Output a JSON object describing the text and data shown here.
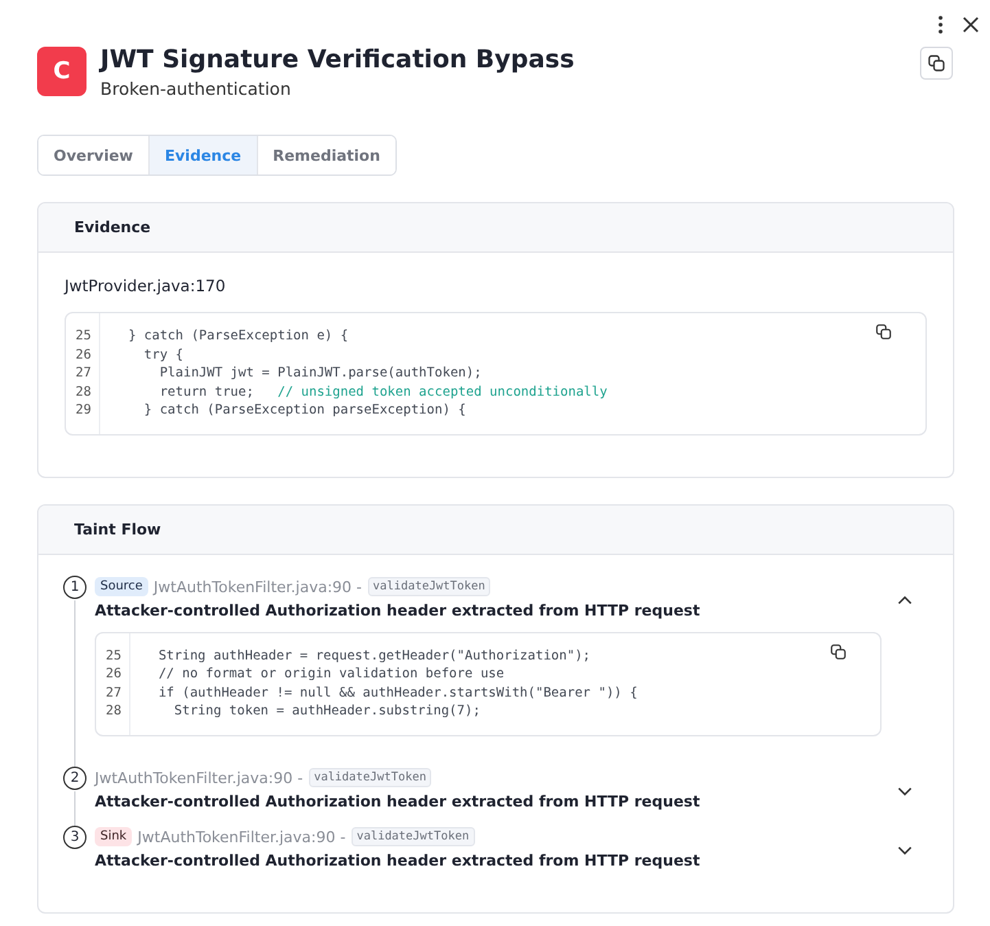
{
  "header": {
    "severity_letter": "C",
    "title": "JWT Signature Verification Bypass",
    "category": "Broken-authentication"
  },
  "tabs": [
    {
      "label": "Overview",
      "selected": false
    },
    {
      "label": "Evidence",
      "selected": true
    },
    {
      "label": "Remediation",
      "selected": false
    }
  ],
  "evidence": {
    "title": "Evidence",
    "location": "JwtProvider.java:170",
    "code": [
      {
        "number": "25",
        "code": "  } catch (ParseException e) {"
      },
      {
        "number": "26",
        "code": "    try {"
      },
      {
        "number": "27",
        "code": "      PlainJWT jwt = PlainJWT.parse(authToken);"
      },
      {
        "number": "28",
        "code": "      return true;   ",
        "comment": "// unsigned token accepted unconditionally"
      },
      {
        "number": "29",
        "code": "    } catch (ParseException parseException) {"
      }
    ]
  },
  "taint_flow": {
    "title": "Taint Flow",
    "steps": [
      {
        "number": "1",
        "badge": "Source",
        "kind": "source",
        "location": "JwtAuthTokenFilter.java:90 -",
        "method": "validateJwtToken",
        "description": "Attacker-controlled Authorization header extracted from HTTP request",
        "expanded": true,
        "code": [
          {
            "number": "25",
            "code": "  String authHeader = request.getHeader(\"Authorization\");"
          },
          {
            "number": "26",
            "code": "  // no format or origin validation before use"
          },
          {
            "number": "27",
            "code": "  if (authHeader != null && authHeader.startsWith(\"Bearer \")) {"
          },
          {
            "number": "28",
            "code": "    String token = authHeader.substring(7);"
          }
        ]
      },
      {
        "number": "2",
        "kind": "step",
        "location": "JwtAuthTokenFilter.java:90 -",
        "method": "validateJwtToken",
        "description": "Attacker-controlled Authorization header extracted from HTTP request",
        "expanded": false
      },
      {
        "number": "3",
        "badge": "Sink",
        "kind": "sink",
        "location": "JwtAuthTokenFilter.java:90 -",
        "method": "validateJwtToken",
        "description": "Attacker-controlled Authorization header extracted from HTTP request",
        "expanded": false
      }
    ]
  }
}
